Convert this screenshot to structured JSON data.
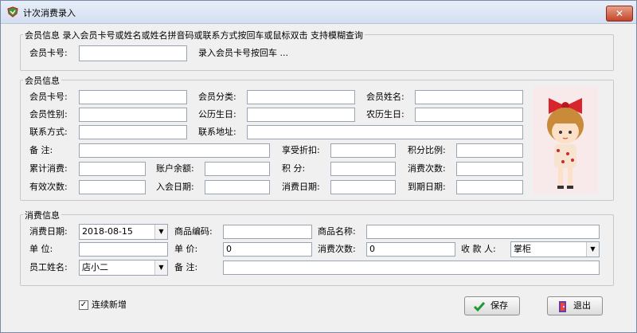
{
  "window": {
    "title": "计次消费录入"
  },
  "search": {
    "group_title": "会员信息 录入会员卡号或姓名或姓名拼音码或联系方式按回车或鼠标双击 支持模糊查询",
    "card_label": "会员卡号:",
    "card_value": "",
    "hint": "录入会员卡号按回车 ..."
  },
  "member": {
    "group_title": "会员信息",
    "labels": {
      "card": "会员卡号:",
      "category": "会员分类:",
      "name": "会员姓名:",
      "gender": "会员性别:",
      "solar_birthday": "公历生日:",
      "lunar_birthday": "农历生日:",
      "contact": "联系方式:",
      "address": "联系地址:",
      "remark": "备    注:",
      "discount": "享受折扣:",
      "points_ratio": "积分比例:",
      "total_spend": "累计消费:",
      "balance": "账户余额:",
      "points": "积    分:",
      "spend_count": "消费次数:",
      "valid_count": "有效次数:",
      "join_date": "入会日期:",
      "spend_date": "消费日期:",
      "expire_date": "到期日期:"
    }
  },
  "consume": {
    "group_title": "消费信息",
    "labels": {
      "date": "消费日期:",
      "product_code": "商品编码:",
      "product_name": "商品名称:",
      "unit": "单    位:",
      "price": "单    价:",
      "count": "消费次数:",
      "payee": "收 款 人:",
      "staff": "员工姓名:",
      "remark": "备    注:"
    },
    "values": {
      "date": "2018-08-15",
      "product_code": "",
      "product_name": "",
      "unit": "",
      "price": "0",
      "count": "0",
      "payee": "掌柜",
      "staff": "店小二",
      "remark": ""
    }
  },
  "footer": {
    "continuous_label": "连续新增",
    "continuous_checked": true,
    "save_label": "保存",
    "exit_label": "退出"
  },
  "colors": {
    "title_bar": "#dce6f4",
    "close_button": "#c3452a",
    "save_icon": "#1f9a2f",
    "exit_icon": "#6a3fa0"
  },
  "icons": [
    "app-shield-icon",
    "close-icon",
    "checkmark-icon",
    "exit-door-icon",
    "dropdown-arrow-icon"
  ]
}
